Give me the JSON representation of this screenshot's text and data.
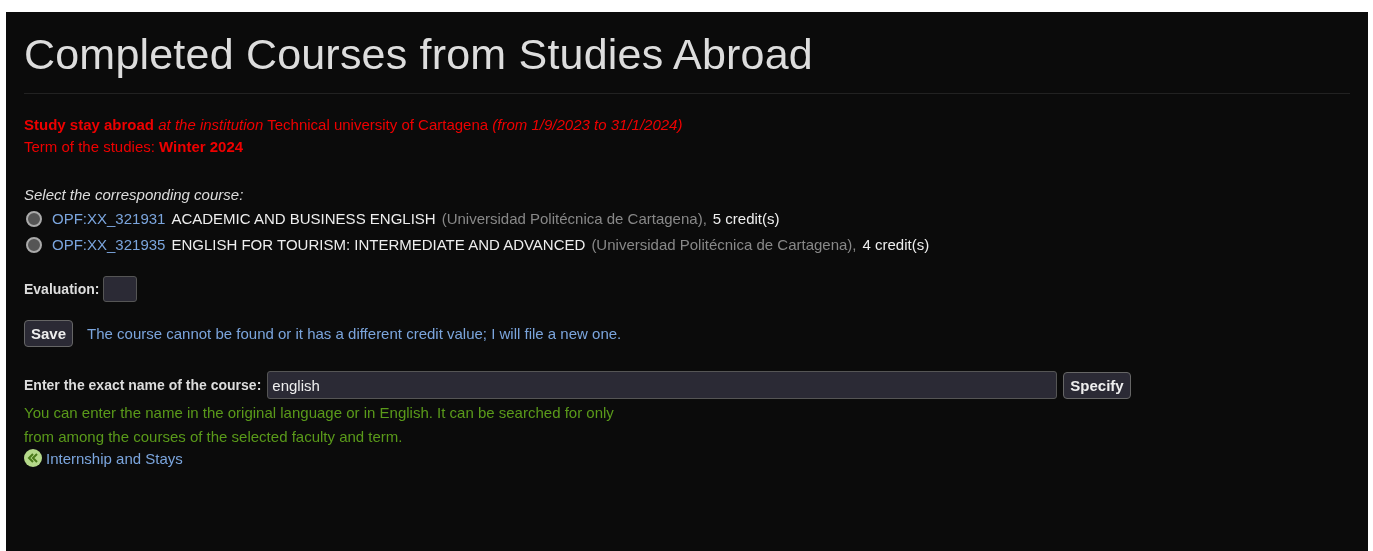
{
  "title": "Completed Courses from Studies Abroad",
  "stay": {
    "line": "**Study stay abroad** *at the institution* Technical university of Cartagena *(from 1/9/2023 to 31/1/2024)*",
    "term": "Term of the studies: **Winter 2024**"
  },
  "course_prompt": "Select the corresponding course:",
  "courses": [
    {
      "code": "OPF:XX_321931",
      "name": "ACADEMIC AND BUSINESS ENGLISH",
      "institution": "(Universidad Politécnica de Cartagena),",
      "credits": "5 credit(s)",
      "selected": false
    },
    {
      "code": "OPF:XX_321935",
      "name": "ENGLISH FOR TOURISM: INTERMEDIATE AND ADVANCED",
      "institution": "(Universidad Politécnica de Cartagena),",
      "credits": "4 credit(s)",
      "selected": false
    }
  ],
  "evaluation": {
    "label": "Evaluation:"
  },
  "save": {
    "button": "Save",
    "link": "The course cannot be found or it has a different credit value; I will file a new one."
  },
  "search": {
    "label": "Enter the exact name of the course:",
    "value": "english",
    "button": "Specify",
    "hint": "You can enter the name in the original language or in English. It can be searched for only\nfrom among the courses of the selected faculty and term."
  },
  "back_link": "Internship and Stays"
}
